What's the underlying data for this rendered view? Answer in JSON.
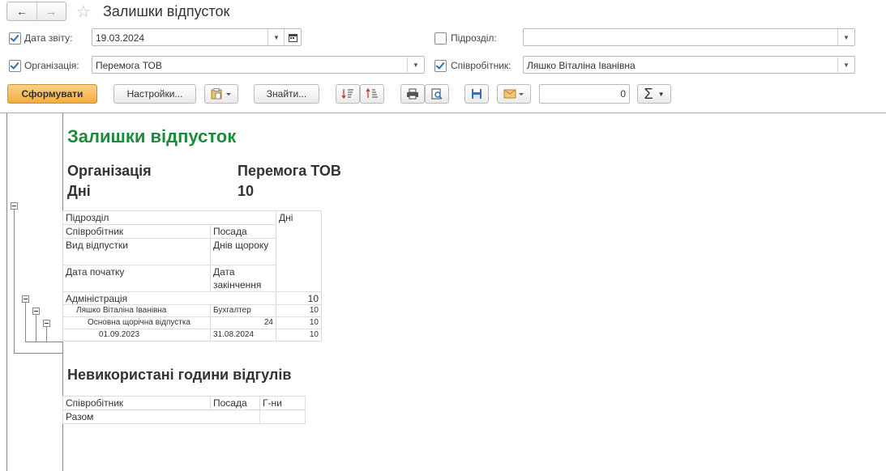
{
  "window": {
    "title": "Залишки відпусток",
    "back_icon": "←",
    "forward_icon": "→",
    "star_icon": "☆"
  },
  "filters": {
    "report_date": {
      "label": "Дата звіту:",
      "value": "19.03.2024",
      "checked": true
    },
    "department": {
      "label": "Підрозділ:",
      "value": "",
      "checked": false
    },
    "organization": {
      "label": "Організація:",
      "value": "Перемога ТОВ",
      "checked": true
    },
    "employee": {
      "label": "Співробітник:",
      "value": "Ляшко Віталіна Іванівна",
      "checked": true
    }
  },
  "toolbar": {
    "generate": "Сформувати",
    "settings": "Настройки...",
    "find": "Знайти...",
    "sum_value": "0",
    "sigma": "Σ"
  },
  "report": {
    "title": "Залишки відпусток",
    "params": [
      {
        "label": "Організація",
        "value": "Перемога ТОВ"
      },
      {
        "label": "Дні",
        "value": "10"
      }
    ],
    "header": {
      "department": "Підрозділ",
      "days": "Дні",
      "employee": "Співробітник",
      "position": "Посада",
      "leave_type": "Вид відпустки",
      "days_per_year": "Днів щороку",
      "start_date": "Дата початку",
      "end_date": "Дата закінчення"
    },
    "rows": {
      "department": {
        "name": "Адміністрація",
        "days": "10"
      },
      "employee": {
        "name": "Ляшко Віталіна Іванівна",
        "position": "Бухгалтер",
        "days": "10"
      },
      "leave": {
        "name": "Основна щорічна відпустка",
        "per_year": "24",
        "days": "10"
      },
      "period": {
        "start": "01.09.2023",
        "end": "31.08.2024",
        "days": "10"
      }
    },
    "section2": {
      "title": "Невикористані години відгулів",
      "col_employee": "Співробітник",
      "col_position": "Посада",
      "col_hours": "Г-ни",
      "total": "Разом"
    }
  }
}
